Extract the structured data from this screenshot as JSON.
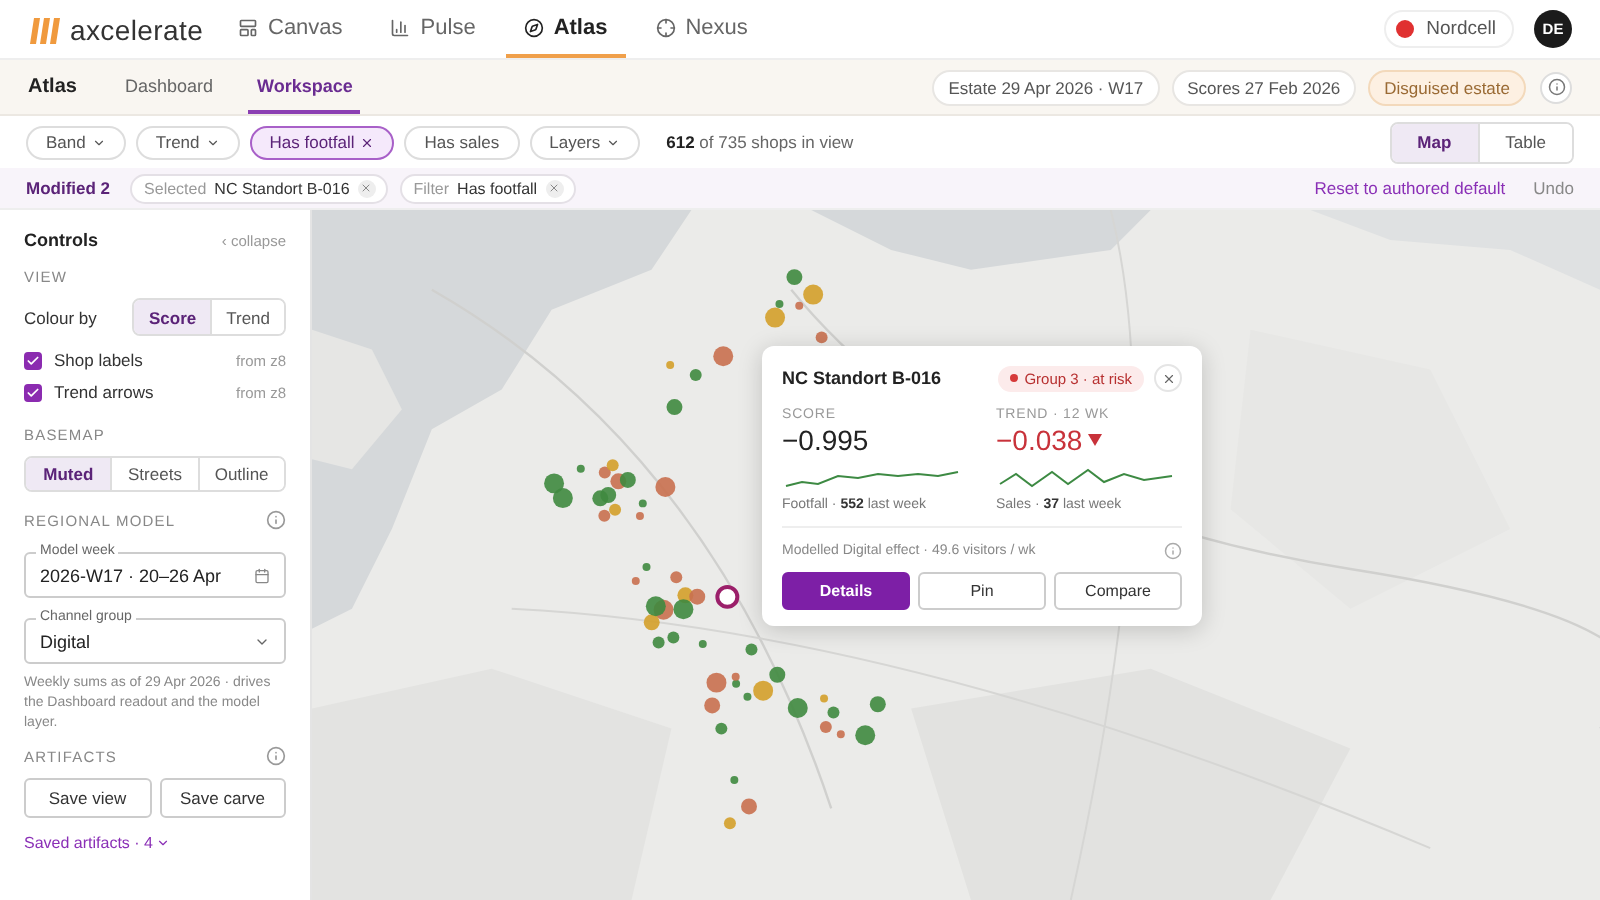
{
  "app": {
    "brand": "axcelerate"
  },
  "nav": [
    {
      "label": "Canvas",
      "selected": false
    },
    {
      "label": "Pulse",
      "selected": false
    },
    {
      "label": "Atlas",
      "selected": true
    },
    {
      "label": "Nexus",
      "selected": false
    }
  ],
  "account": {
    "org": "Nordcell",
    "avatar": "DE"
  },
  "subheader": {
    "title": "Atlas",
    "tabs": [
      {
        "label": "Dashboard",
        "selected": false
      },
      {
        "label": "Workspace",
        "selected": true
      }
    ],
    "chips": [
      {
        "label": "Estate 29 Apr 2026 · W17",
        "kind": "plain"
      },
      {
        "label": "Scores 27 Feb 2026",
        "kind": "plain"
      },
      {
        "label": "Disguised estate",
        "kind": "warning"
      }
    ]
  },
  "filters": [
    {
      "label": "Band",
      "kind": "dropdown",
      "active": false
    },
    {
      "label": "Trend",
      "kind": "dropdown",
      "active": false
    },
    {
      "label": "Has footfall",
      "kind": "toggle",
      "active": true
    },
    {
      "label": "Has sales",
      "kind": "toggle",
      "active": false
    },
    {
      "label": "Layers",
      "kind": "dropdown",
      "active": false
    }
  ],
  "shop_count": "**612** of 735 shops in view",
  "view_switch": [
    {
      "label": "Map",
      "selected": true
    },
    {
      "label": "Table",
      "selected": false
    }
  ],
  "modified": {
    "label": "Modified 2",
    "chips": [
      {
        "key": "Selected",
        "value": "NC Standort B-016"
      },
      {
        "key": "Filter",
        "value": "Has footfall"
      }
    ],
    "reset": "Reset to authored default",
    "undo": "Undo"
  },
  "controls": {
    "title": "Controls",
    "collapse": "‹ collapse",
    "view": {
      "heading": "VIEW",
      "colour_by": {
        "label": "Colour by",
        "options": [
          {
            "label": "Score",
            "selected": true
          },
          {
            "label": "Trend",
            "selected": false
          }
        ]
      },
      "toggles": [
        {
          "label": "Shop labels",
          "hint": "from z8",
          "checked": true
        },
        {
          "label": "Trend arrows",
          "hint": "from z8",
          "checked": true
        }
      ]
    },
    "basemap": {
      "heading": "BASEMAP",
      "options": [
        {
          "label": "Muted",
          "selected": true
        },
        {
          "label": "Streets",
          "selected": false
        },
        {
          "label": "Outline",
          "selected": false
        }
      ]
    },
    "regional_model": {
      "heading": "REGIONAL MODEL",
      "fields": [
        {
          "label": "Model week",
          "value": "2026-W17 · 20–26 Apr",
          "kind": "date"
        },
        {
          "label": "Channel group",
          "value": "Digital",
          "kind": "select"
        }
      ],
      "note": "Weekly sums as of 29 Apr 2026 · drives the Dashboard readout and the model layer."
    },
    "artifacts": {
      "heading": "ARTIFACTS",
      "buttons": [
        "Save view",
        "Save carve"
      ],
      "saved": "Saved artifacts · 4"
    }
  },
  "popup": {
    "title": "NC Standort B-016",
    "badge": "Group 3 · at risk",
    "score": {
      "label": "SCORE",
      "value": "−0.995",
      "caption": "Footfall · **552** last week"
    },
    "trend": {
      "label": "TREND · 12 WK",
      "value": "−0.038",
      "caption": "Sales · **37** last week"
    },
    "effect": "Modelled Digital effect · 49.6 visitors / wk",
    "buttons": [
      {
        "label": "Details",
        "kind": "primary"
      },
      {
        "label": "Pin",
        "kind": "secondary"
      },
      {
        "label": "Compare",
        "kind": "secondary"
      }
    ]
  }
}
